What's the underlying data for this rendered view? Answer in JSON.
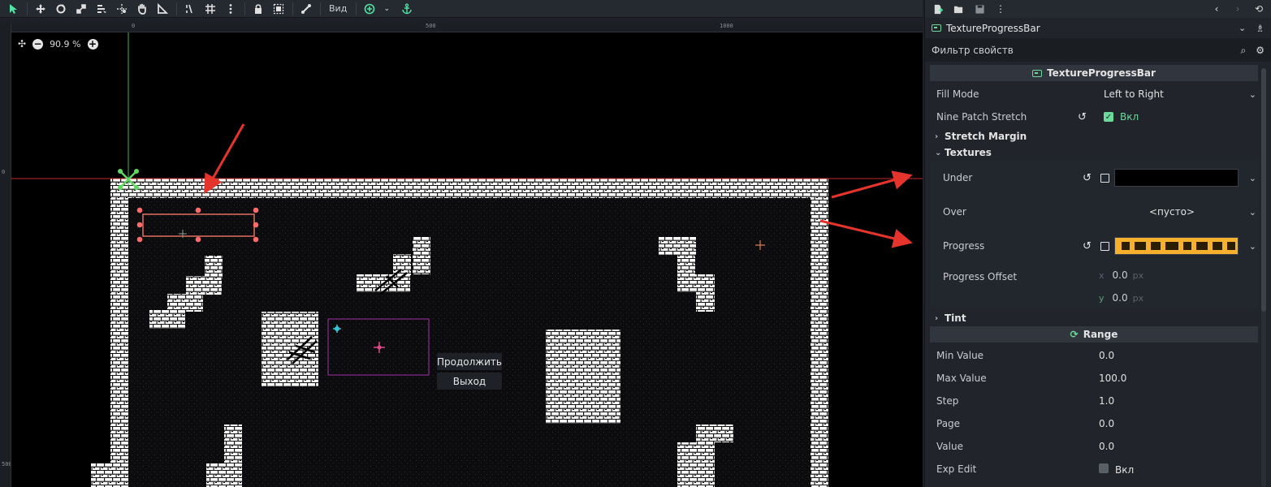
{
  "toolbar": {
    "view_label": "Вид"
  },
  "zoom": {
    "label": "90.9 %"
  },
  "ruler": {
    "top_labels": [
      "0",
      "500",
      "1000"
    ],
    "left_labels": [
      "0",
      "500"
    ]
  },
  "game_menu": {
    "continue_label": "Продолжить",
    "exit_label": "Выход"
  },
  "inspector": {
    "node_name": "TextureProgressBar",
    "filter_placeholder": "Фильтр свойств",
    "category": "TextureProgressBar",
    "fill_mode": {
      "label": "Fill Mode",
      "value": "Left to Right"
    },
    "nine_patch": {
      "label": "Nine Patch Stretch",
      "value": "Вкл"
    },
    "stretch_margin": "Stretch Margin",
    "textures": {
      "title": "Textures",
      "under": "Under",
      "over": "Over",
      "over_value": "<пусто>",
      "progress": "Progress",
      "progress_offset": "Progress Offset",
      "offset_x_axis": "x",
      "offset_x": "0.0",
      "offset_y_axis": "y",
      "offset_y": "0.0",
      "unit": "px"
    },
    "tint": "Tint",
    "range": {
      "title": "Range",
      "rows": [
        {
          "label": "Min Value",
          "value": "0.0"
        },
        {
          "label": "Max Value",
          "value": "100.0"
        },
        {
          "label": "Step",
          "value": "1.0"
        },
        {
          "label": "Page",
          "value": "0.0"
        },
        {
          "label": "Value",
          "value": "0.0"
        }
      ],
      "exp_edit": {
        "label": "Exp Edit",
        "value": "Вкл"
      }
    }
  },
  "colors": {
    "accent_green": "#6bd99a",
    "arrow_red": "#e5342c",
    "progress_texture": "#f5b02e"
  }
}
